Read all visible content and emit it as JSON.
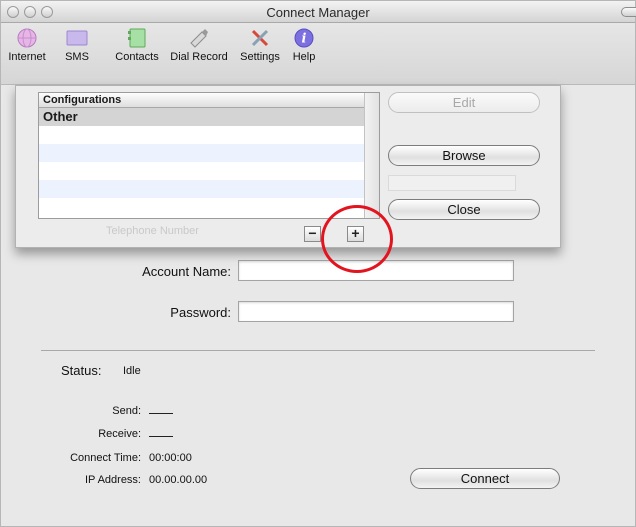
{
  "window": {
    "title": "Connect Manager"
  },
  "toolbar": {
    "items": [
      {
        "label": "Internet",
        "icon": "globe-icon"
      },
      {
        "label": "SMS",
        "icon": "sms-icon"
      },
      {
        "label": "Contacts",
        "icon": "contacts-icon"
      },
      {
        "label": "Dial Record",
        "icon": "dial-record-icon"
      },
      {
        "label": "Settings",
        "icon": "settings-icon"
      },
      {
        "label": "Help",
        "icon": "help-icon"
      }
    ]
  },
  "sheet": {
    "list_header": "Configurations",
    "rows": [
      "Other",
      "",
      "",
      "",
      ""
    ],
    "hint": "Telephone Number",
    "minus": "−",
    "plus": "+",
    "edit": "Edit",
    "browse": "Browse",
    "close": "Close"
  },
  "form": {
    "account_label": "Account Name:",
    "account_value": "",
    "password_label": "Password:",
    "password_value": ""
  },
  "status": {
    "label": "Status:",
    "value": "Idle",
    "send_label": "Send:",
    "receive_label": "Receive:",
    "connect_time_label": "Connect Time:",
    "connect_time": "00:00:00",
    "ip_label": "IP Address:",
    "ip": "00.00.00.00"
  },
  "connect_button": "Connect",
  "colors": {
    "annotation": "#e2141f",
    "selected_row": "#d4d4d4",
    "alt_row": "#edf3fe"
  }
}
